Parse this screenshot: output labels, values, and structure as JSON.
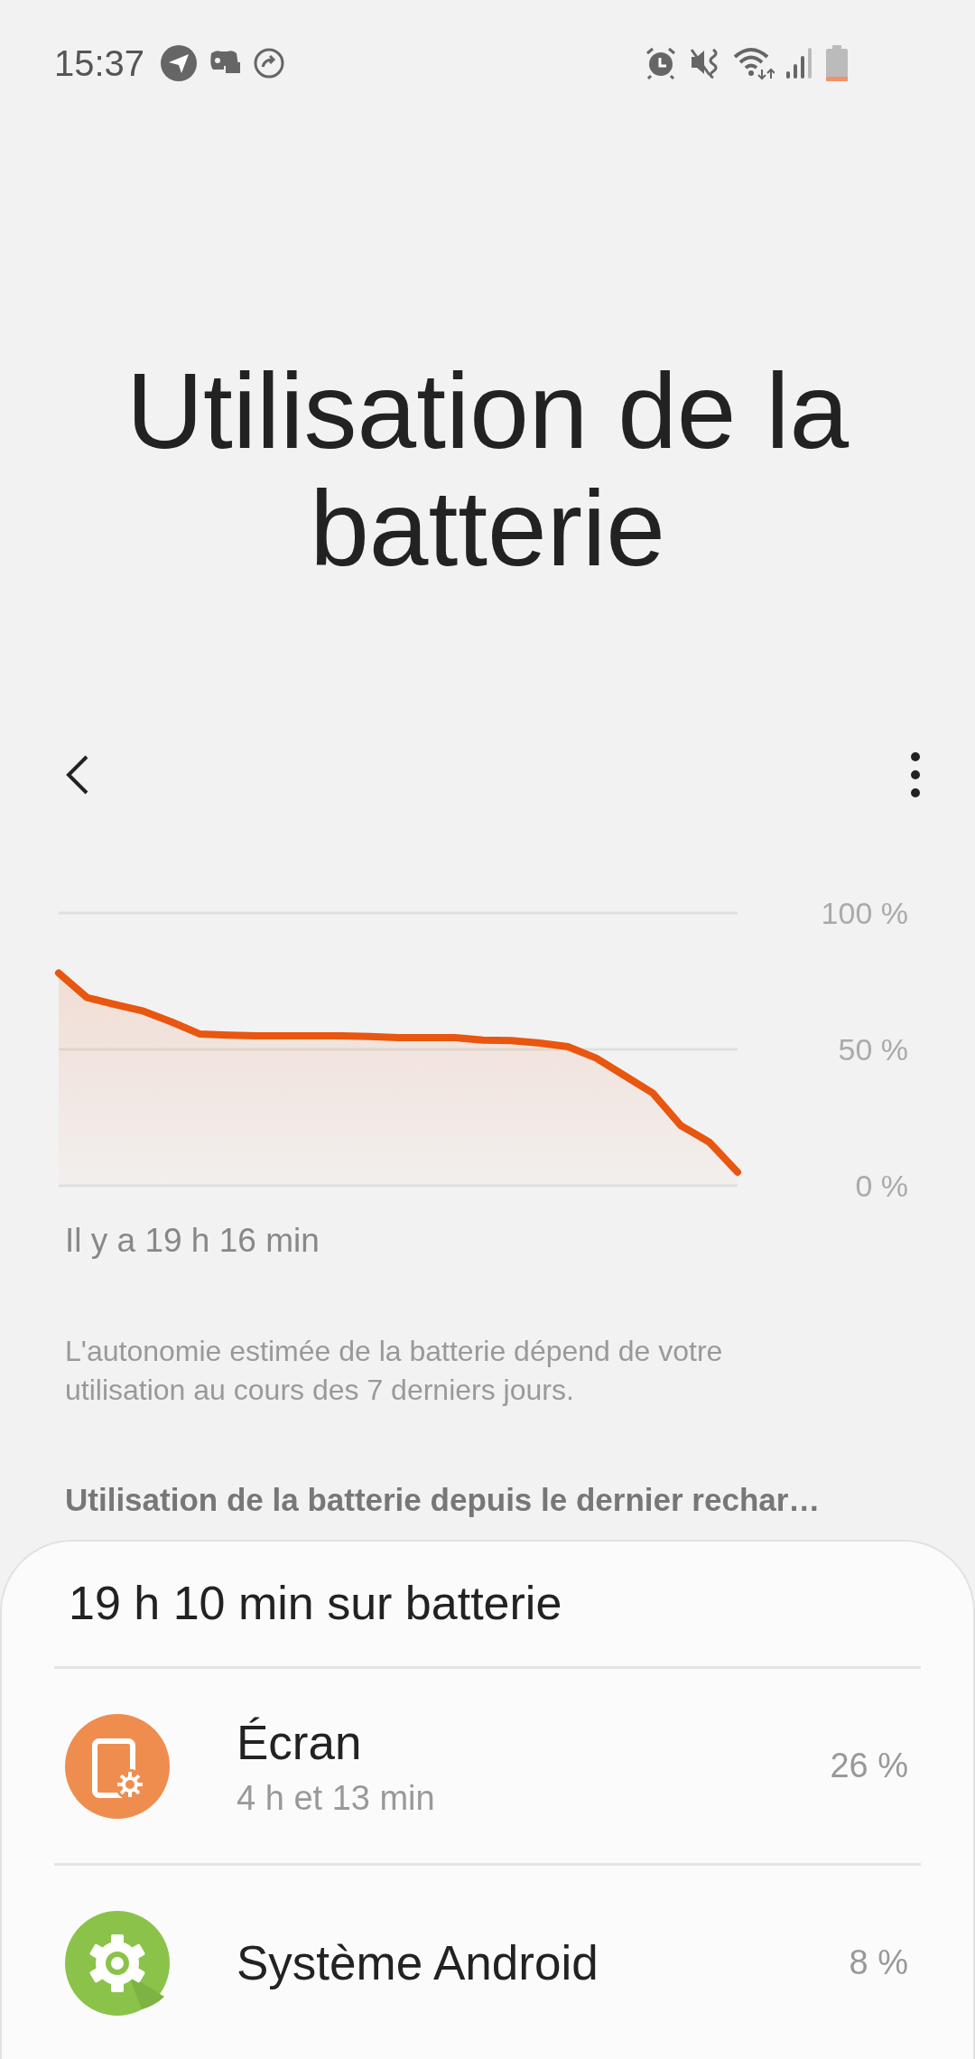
{
  "status_bar": {
    "time": "15:37"
  },
  "title": "Utilisation de la batterie",
  "chart": {
    "chart_data": {
      "type": "area",
      "ylim": [
        0,
        100
      ],
      "yticks": [
        {
          "value": 100,
          "label": "100 %"
        },
        {
          "value": 50,
          "label": "50 %"
        },
        {
          "value": 0,
          "label": "0 %"
        }
      ],
      "categories": [
        null,
        null,
        null,
        null,
        null,
        null,
        null,
        null,
        null,
        null,
        null,
        null,
        null,
        null,
        null,
        null,
        null,
        null,
        null,
        null,
        null,
        null,
        null,
        null,
        null
      ],
      "series": [
        {
          "color": "#e8560f",
          "values": [
            78,
            69,
            66.4,
            64,
            60,
            55.6,
            55.2,
            55,
            55,
            55,
            55,
            54.7,
            54.3,
            54.3,
            54.3,
            53.4,
            53.2,
            52.3,
            51,
            46.8,
            40.4,
            34,
            22,
            16,
            5
          ]
        }
      ]
    },
    "caption": "Il y a 19 h 16 min"
  },
  "note": "L'autonomie estimée de la batterie dépend de votre utilisation au cours des 7 derniers jours.",
  "section_header": "Utilisation de la batterie depuis le dernier rechar…",
  "usage_card": {
    "total": "19 h 10 min sur batterie",
    "apps": [
      {
        "kind": "screen",
        "name": "Écran",
        "duration": "4 h et 13 min",
        "percent": "26 %"
      },
      {
        "kind": "system",
        "name": "Système Android",
        "percent": "8 %"
      }
    ]
  }
}
